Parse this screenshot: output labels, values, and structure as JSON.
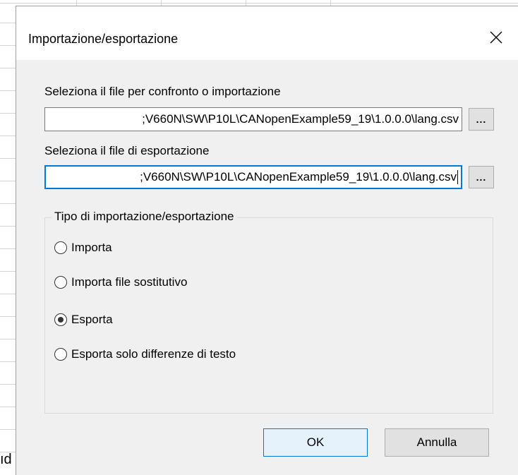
{
  "background": {
    "cell_text": "ıd"
  },
  "dialog": {
    "title": "Importazione/esportazione",
    "close_glyph": "✕",
    "compare_label": "Seleziona il file per confronto o importazione",
    "compare_path": ";V660N\\SW\\P10L\\CANopenExample59_19\\1.0.0.0\\lang.csv",
    "compare_browse": "...",
    "export_label": "Seleziona il file di esportazione",
    "export_path": ";V660N\\SW\\P10L\\CANopenExample59_19\\1.0.0.0\\lang.csv",
    "export_browse": "...",
    "group": {
      "title": "Tipo di importazione/esportazione",
      "options": [
        {
          "label": "Importa",
          "checked": false
        },
        {
          "label": "Importa file sostitutivo",
          "checked": false
        },
        {
          "label": "Esporta",
          "checked": true
        },
        {
          "label": "Esporta solo differenze di testo",
          "checked": false
        }
      ]
    },
    "ok_label": "OK",
    "cancel_label": "Annulla"
  },
  "colors": {
    "dialog_bg": "#f0f0f0",
    "focus_border": "#0078d7",
    "default_button_bg": "#e5f1fb"
  }
}
